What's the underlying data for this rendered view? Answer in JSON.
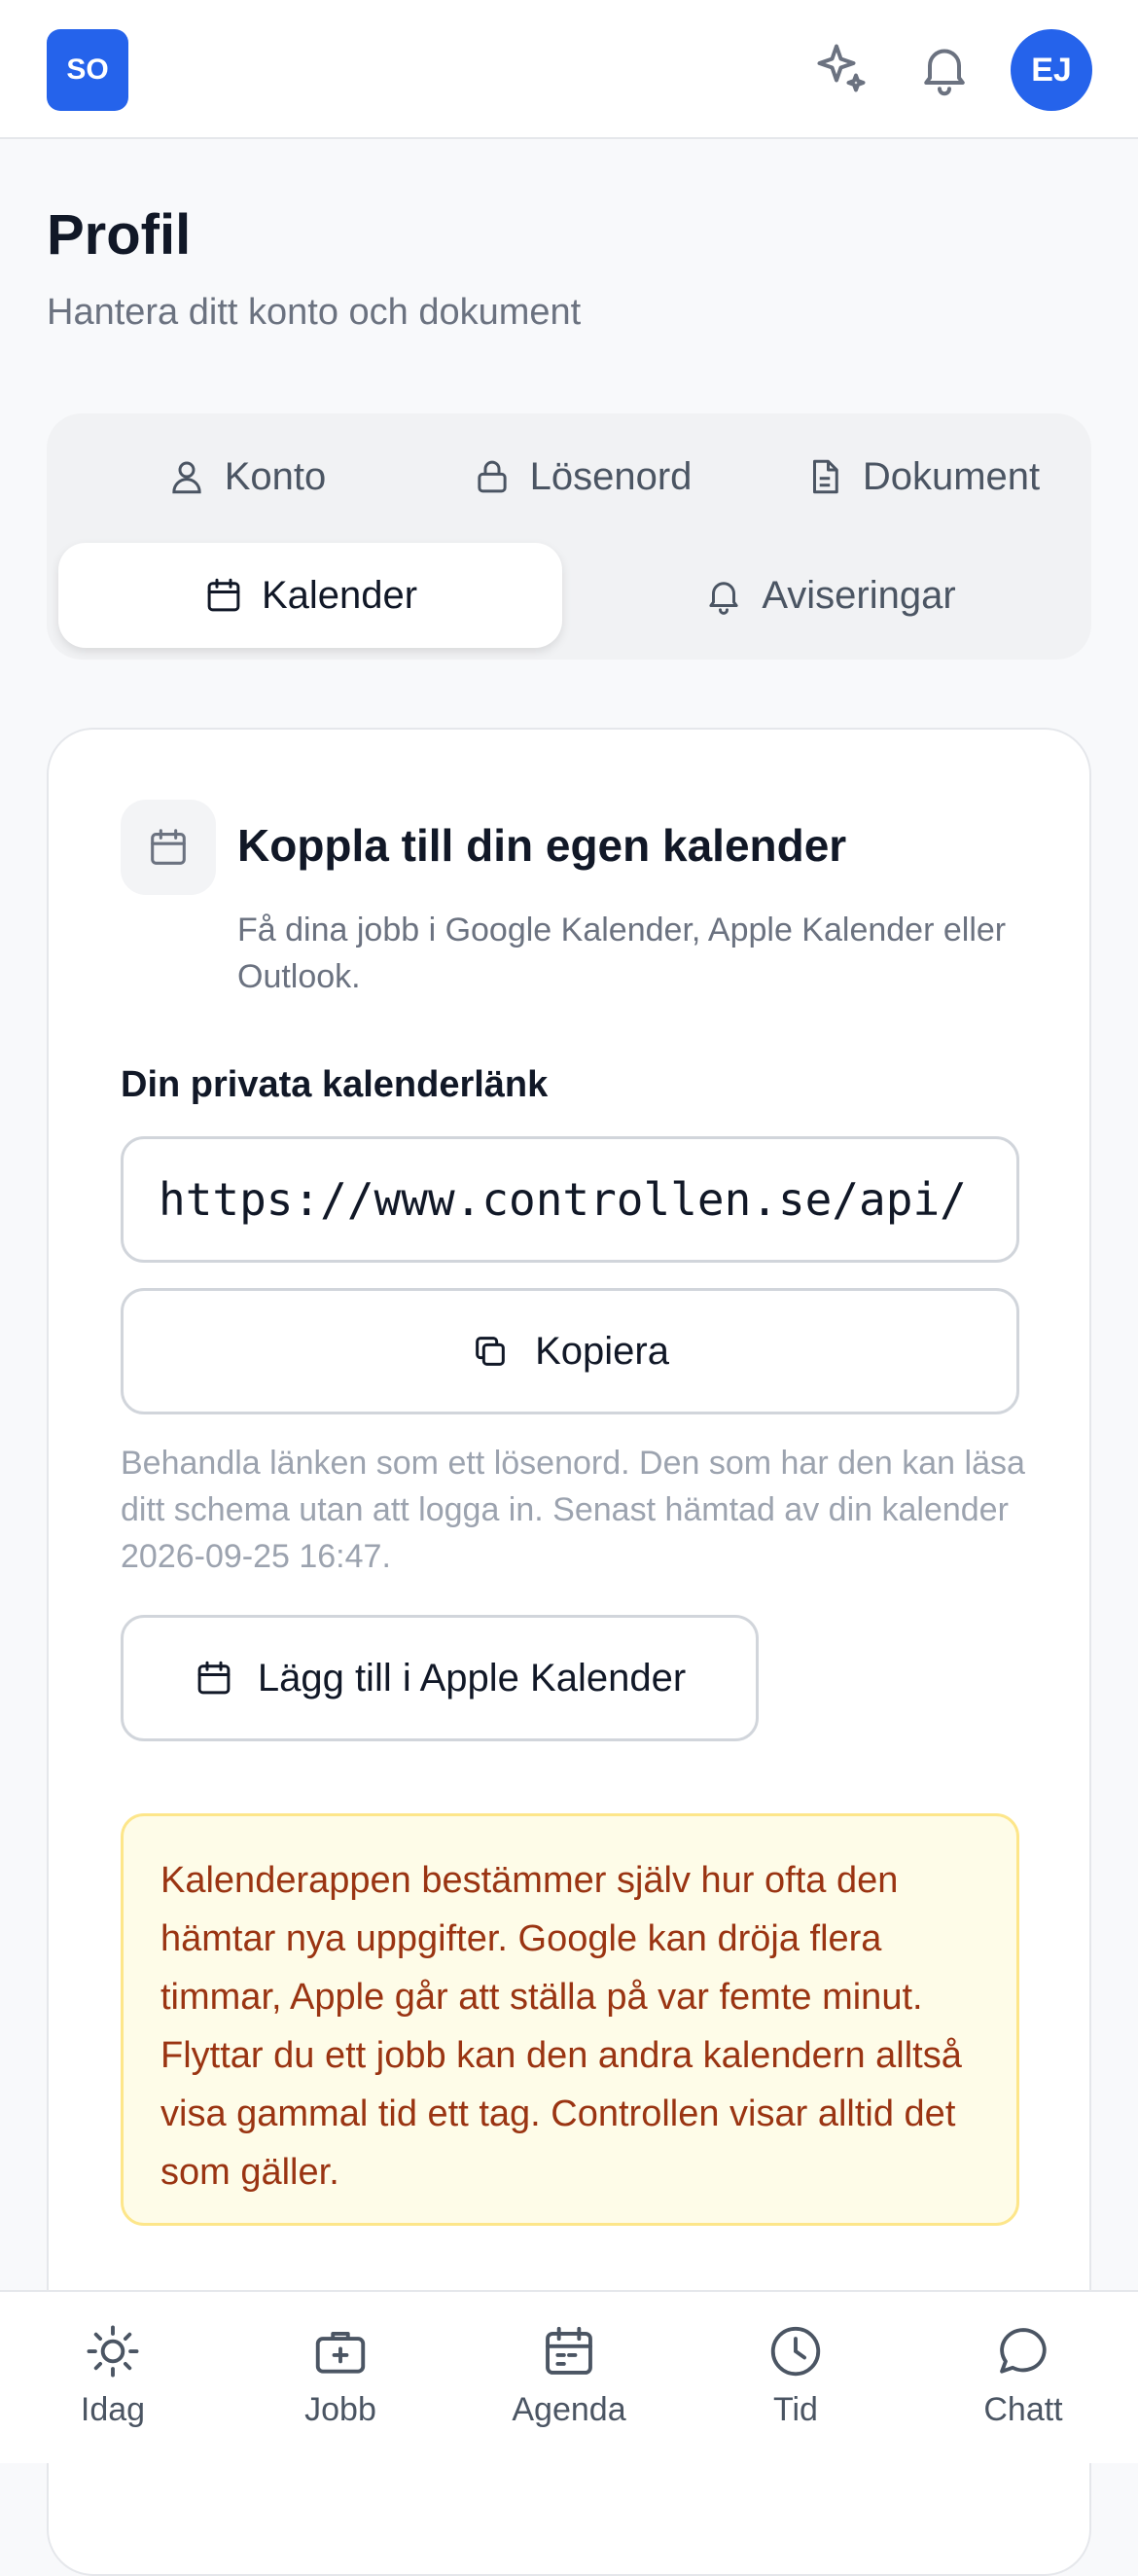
{
  "header": {
    "logo_text": "SO",
    "avatar_text": "EJ",
    "brand_color": "#2563eb",
    "icons": [
      "sparkles-icon",
      "bell-icon"
    ]
  },
  "page": {
    "title": "Profil",
    "subtitle": "Hantera ditt konto och dokument"
  },
  "tabs": [
    {
      "label": "Konto",
      "icon": "user-icon",
      "active": false
    },
    {
      "label": "Lösenord",
      "icon": "lock-icon",
      "active": false
    },
    {
      "label": "Dokument",
      "icon": "document-icon",
      "active": false
    },
    {
      "label": "Kalender",
      "icon": "calendar-icon",
      "active": true
    },
    {
      "label": "Aviseringar",
      "icon": "bell-icon",
      "active": false
    }
  ],
  "calendar_card": {
    "title": "Koppla till din egen kalender",
    "description": "Få dina jobb i Google Kalender, Apple Kalender eller Outlook.",
    "link_label": "Din privata kalenderlänk",
    "link_value": "https://www.controllen.se/api/",
    "copy_label": "Kopiera",
    "hint": "Behandla länken som ett lösenord. Den som har den kan läsa ditt schema utan att logga in. Senast hämtad av din kalender 2026-09-25 16:47.",
    "apple_label": "Lägg till i Apple Kalender",
    "notice": "Kalenderappen bestämmer själv hur ofta den hämtar nya uppgifter. Google kan dröja flera timmar, Apple går att ställa på var femte minut. Flyttar du ett jobb kan den andra kalendern alltså visa gammal tid ett tag. Controllen visar alltid det som gäller."
  },
  "bottom_nav": [
    {
      "label": "Idag",
      "icon": "sun-icon"
    },
    {
      "label": "Jobb",
      "icon": "briefcase-icon"
    },
    {
      "label": "Agenda",
      "icon": "calendar-icon"
    },
    {
      "label": "Tid",
      "icon": "clock-icon"
    },
    {
      "label": "Chatt",
      "icon": "chat-icon"
    }
  ]
}
